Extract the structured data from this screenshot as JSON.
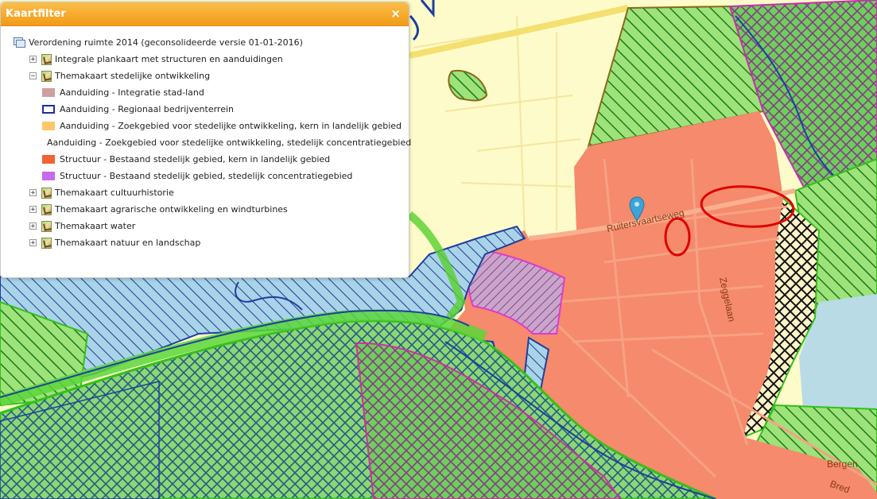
{
  "panel": {
    "title": "Kaartfilter",
    "close_label": "×",
    "root_label": "Verordening ruimte 2014 (geconsolideerde versie 01-01-2016)",
    "layers_before": [
      {
        "expander": "+",
        "label": "Integrale plankaart met structuren en aanduidingen"
      },
      {
        "expander": "−",
        "label": "Themakaart stedelijke ontwikkeling"
      }
    ],
    "legend": [
      {
        "label": "Aanduiding - Integratie stad-land",
        "fill": "#cfa0a0",
        "border": "#cfa0a0"
      },
      {
        "label": "Aanduiding - Regionaal bedrijventerrein",
        "fill": "#ffffff",
        "border": "#1f2e9e"
      },
      {
        "label": "Aanduiding - Zoekgebied voor stedelijke ontwikkeling, kern in landelijk gebied",
        "fill": "#fcc86a",
        "border": "#fcc86a"
      },
      {
        "label": "Aanduiding - Zoekgebied voor stedelijke ontwikkeling, stedelijk concentratiegebied",
        "fill": "#f9c8f0",
        "border": "#f9c8f0"
      },
      {
        "label": "Structuur - Bestaand stedelijk gebied, kern in landelijk gebied",
        "fill": "#f26235",
        "border": "#f26235"
      },
      {
        "label": "Structuur - Bestaand stedelijk gebied, stedelijk concentratiegebied",
        "fill": "#c76af0",
        "border": "#c76af0"
      }
    ],
    "layers_after": [
      {
        "expander": "+",
        "label": "Themakaart cultuurhistorie"
      },
      {
        "expander": "+",
        "label": "Themakaart agrarische ontwikkeling en windturbines"
      },
      {
        "expander": "+",
        "label": "Themakaart water"
      },
      {
        "expander": "+",
        "label": "Themakaart natuur en landschap"
      }
    ]
  },
  "map": {
    "street_labels": [
      "Ruitersvaartseweg",
      "Zeggelaan",
      "Bergen",
      "Bred"
    ],
    "marker_icon": "map-pin-icon",
    "colors": {
      "base": "#fdfbc9",
      "urban": "#f58a6c",
      "nature_green": "#57d12e",
      "water_blue": "#1f3f9e",
      "nature_pink": "#d0309e",
      "annotation_red": "#e00000"
    }
  }
}
